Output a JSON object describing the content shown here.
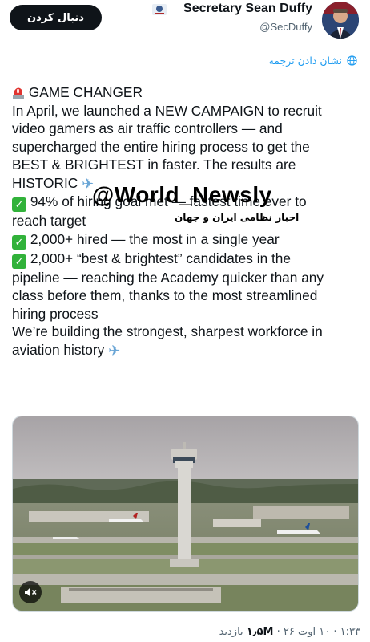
{
  "header": {
    "follow_label": "دنبال کردن",
    "display_name": "Secretary Sean Duffy",
    "handle": "@SecDuffy"
  },
  "translate_label": "نشان دادن ترجمه",
  "tweet": {
    "heading": "GAME CHANGER",
    "p1_l1": "In April, we launched a NEW CAMPAIGN to recruit",
    "p1_l2": "video gamers as air traffic controllers — and",
    "p1_l3": "supercharged the entire hiring process to get the",
    "p1_l4": "BEST & BRIGHTEST in faster. The results are",
    "p1_l5": "HISTORIC",
    "b1_l1": "94% of hiring goal met — fastest time ever to",
    "b1_l2": "reach target",
    "b2_l1": "2,000+ hired — the most in a single year",
    "b3_l1": "2,000+ “best & brightest” candidates in the",
    "b3_l2": "pipeline — reaching the Academy quicker than any",
    "b3_l3": "class before them, thanks to the most streamlined",
    "b3_l4": "hiring process",
    "p2_l1": "We’re building the strongest, sharpest workforce in",
    "p2_l2": "aviation history"
  },
  "watermark": {
    "channel": "@World_Newsly",
    "subtitle": "اخبار نظامی ایران و جهان"
  },
  "meta": {
    "time": "۱:۳۳",
    "sep": "·",
    "date": "۱۰ اوت ۲۶",
    "views_count": "۱٫۵M",
    "views_label": "بازدید"
  },
  "icons": {
    "check": "check-mark-emoji",
    "siren": "siren-emoji",
    "plane": "airplane-emoji",
    "globe": "globe-icon",
    "mute": "speaker-muted-icon"
  },
  "colors": {
    "link": "#1d9bf0",
    "text": "#0f1419",
    "muted": "#536471",
    "check": "#31b23a"
  }
}
